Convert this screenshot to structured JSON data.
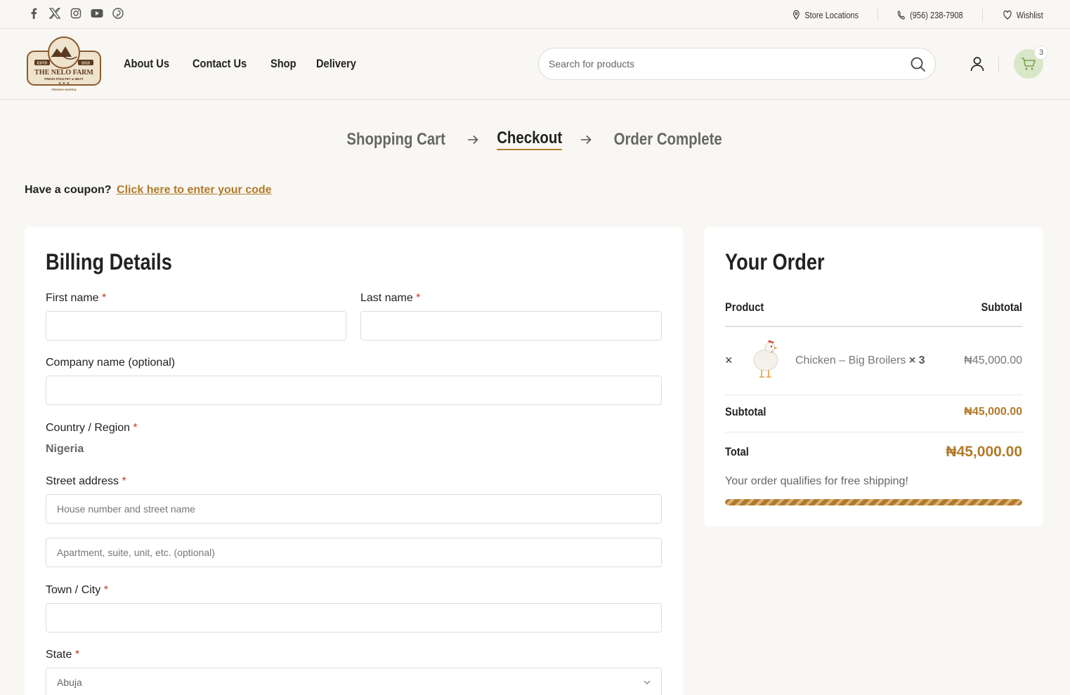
{
  "topbar": {
    "social": [
      "facebook-icon",
      "x-icon",
      "instagram-icon",
      "youtube-icon",
      "pinterest-icon"
    ],
    "store_locations": "Store Locations",
    "phone": "(956) 238-7908",
    "wishlist": "Wishlist"
  },
  "header": {
    "logo": {
      "top": "ESTD",
      "year": "2015",
      "name": "THE NELO FARM",
      "tagline": "FRESH POULTRY & MEAT",
      "bottom": "FEEDING NIGERIA"
    },
    "nav": [
      "About Us",
      "Contact Us",
      "Shop",
      "Delivery"
    ],
    "search_placeholder": "Search for products",
    "cart_count": "3"
  },
  "steps": {
    "cart": "Shopping Cart",
    "checkout": "Checkout",
    "complete": "Order Complete"
  },
  "coupon": {
    "question": "Have a coupon?",
    "link": "Click here to enter your code"
  },
  "billing": {
    "title": "Billing Details",
    "first_name": "First name",
    "last_name": "Last name",
    "company": "Company name (optional)",
    "country_label": "Country / Region",
    "country_value": "Nigeria",
    "street_label": "Street address",
    "street_placeholder": "House number and street name",
    "apt_placeholder": "Apartment, suite, unit, etc. (optional)",
    "city_label": "Town / City",
    "state_label": "State",
    "state_value": "Abuja",
    "required_mark": "*"
  },
  "order": {
    "title": "Your Order",
    "col_product": "Product",
    "col_subtotal": "Subtotal",
    "item_name": "Chicken – Big Broilers",
    "item_qty": "× 3",
    "item_price": "₦45,000.00",
    "subtotal_label": "Subtotal",
    "subtotal_value": "₦45,000.00",
    "total_label": "Total",
    "total_value": "₦45,000.00",
    "free_shipping": "Your order qualifies for free shipping!",
    "free_shipping_progress": 1.0
  },
  "colors": {
    "accent": "#b17a2a",
    "cart_bg": "#d8e7c7",
    "page_bg": "#f9f7f3"
  }
}
